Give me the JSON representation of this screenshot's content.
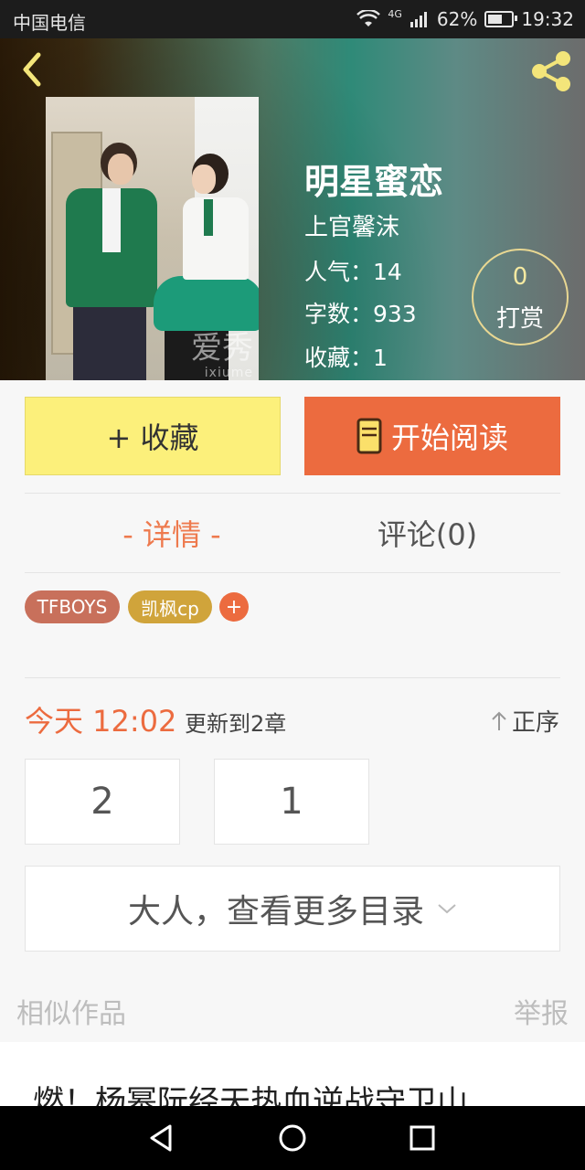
{
  "status_bar": {
    "carrier": "中国电信",
    "network": "4G",
    "battery_percent": "62%",
    "battery_level": 0.62,
    "time": "19:32"
  },
  "book": {
    "title": "明星蜜恋",
    "author": "上官馨沫",
    "popularity": "人气：14",
    "word_count": "字数：933",
    "favorites": "收藏：1",
    "reward_count": "0",
    "reward_label": "打赏",
    "cover_watermark": "爱秀",
    "cover_watermark_sub": "ixiume"
  },
  "actions": {
    "collect_label": "+ 收藏",
    "read_label": "开始阅读"
  },
  "tabs": [
    {
      "label": "- 详情 -",
      "active": true
    },
    {
      "label": "评论(0)",
      "active": false
    }
  ],
  "tags": [
    {
      "label": "TFBOYS",
      "color": "#c8705b"
    },
    {
      "label": "凯枫cp",
      "color": "#d0a43b"
    }
  ],
  "tag_add_label": "+",
  "update": {
    "time": "今天 12:02",
    "text": "更新到2章",
    "sort_label": "正序"
  },
  "chapters": [
    "2",
    "1"
  ],
  "more_catalog_label": "大人，查看更多目录",
  "similar": {
    "label": "相似作品",
    "report_label": "举报",
    "items": [
      {
        "title": "燃！杨幂阮经天热血逆战守卫山"
      }
    ]
  },
  "colors": {
    "accent": "#ec6b3f",
    "collect_bg": "#fcf07b",
    "reward_border": "#e8d792"
  }
}
